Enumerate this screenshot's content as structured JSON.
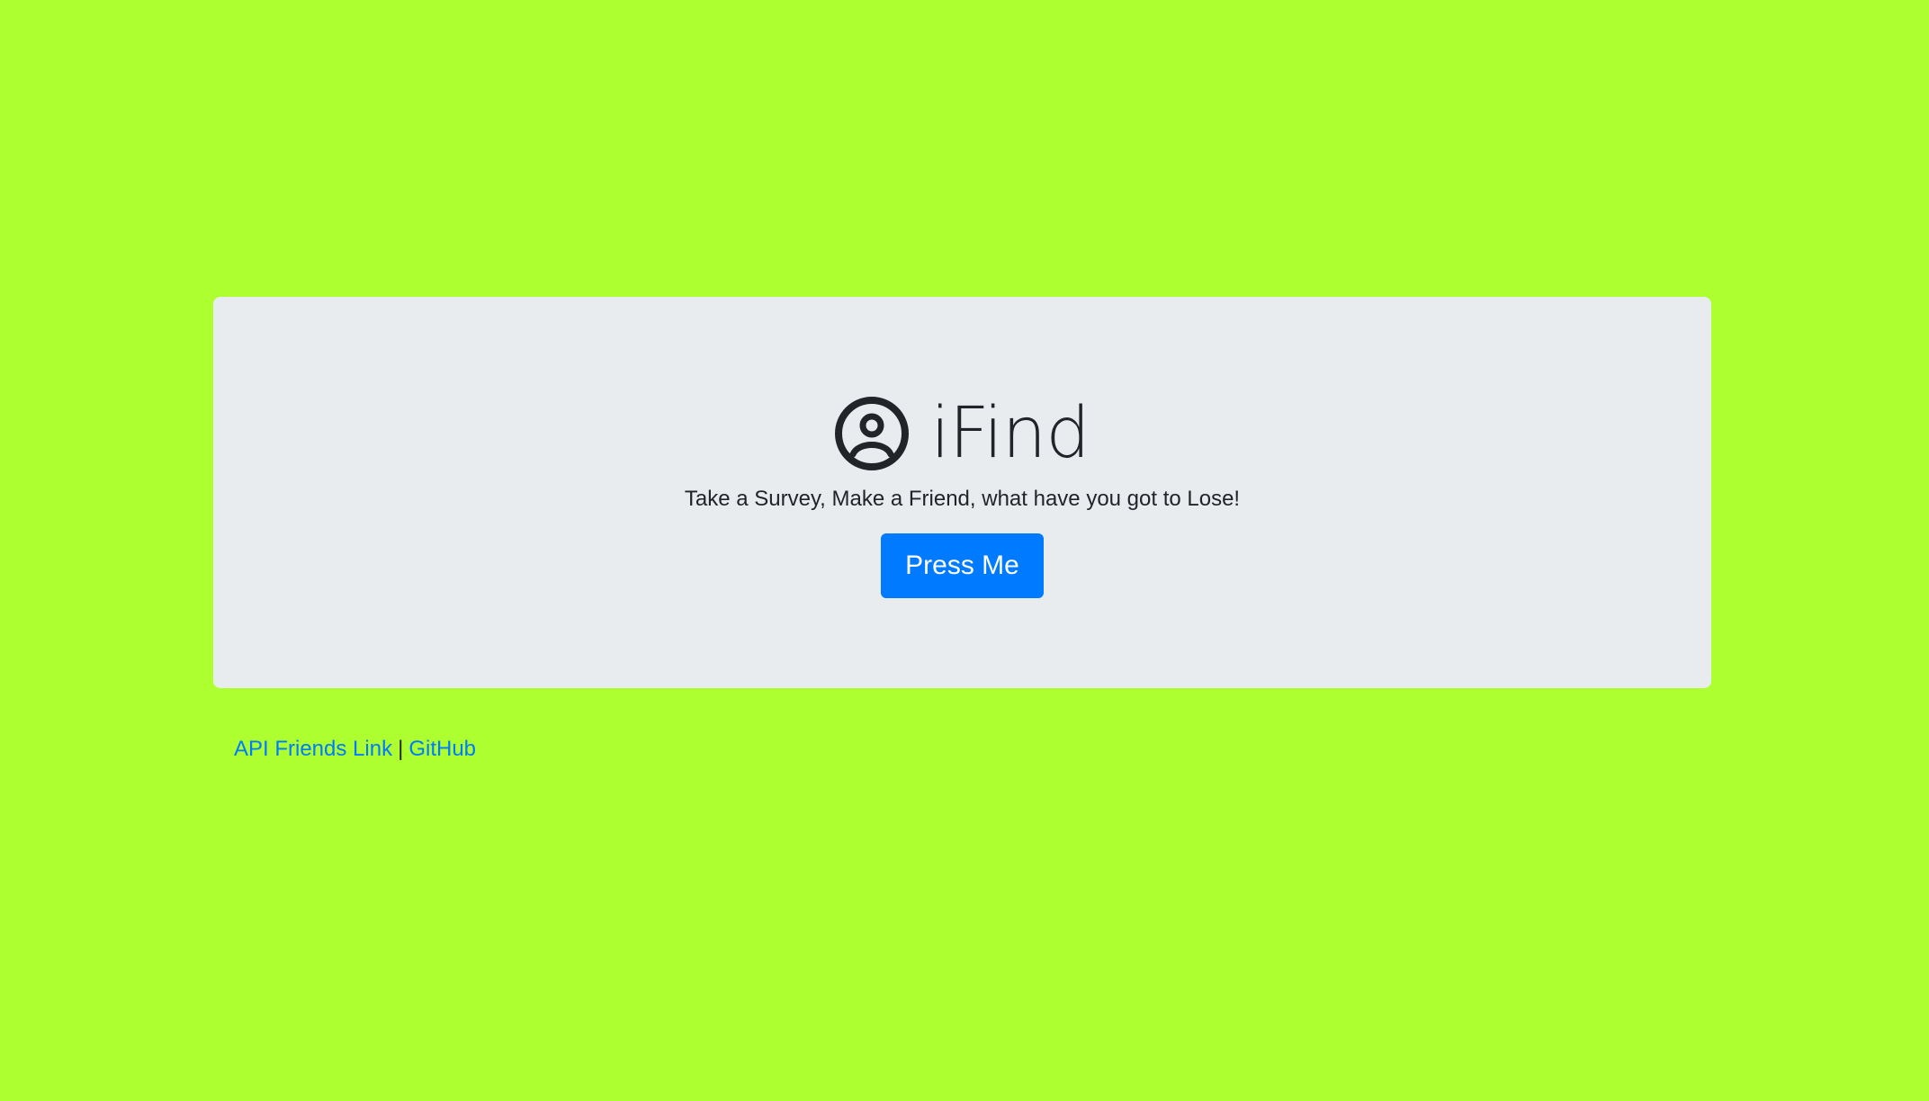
{
  "page": {
    "background_color": "#adff2f"
  },
  "hero": {
    "icon": "user-circle-icon",
    "title": "iFind",
    "tagline": "Take a Survey, Make a Friend, what have you got to Lose!",
    "button_label": "Press Me",
    "button_color": "#007bff",
    "panel_color": "#e9ecef"
  },
  "footer": {
    "links": [
      {
        "label": "API Friends Link"
      },
      {
        "label": "GitHub"
      }
    ],
    "separator": "|",
    "link_color": "#007bff"
  }
}
